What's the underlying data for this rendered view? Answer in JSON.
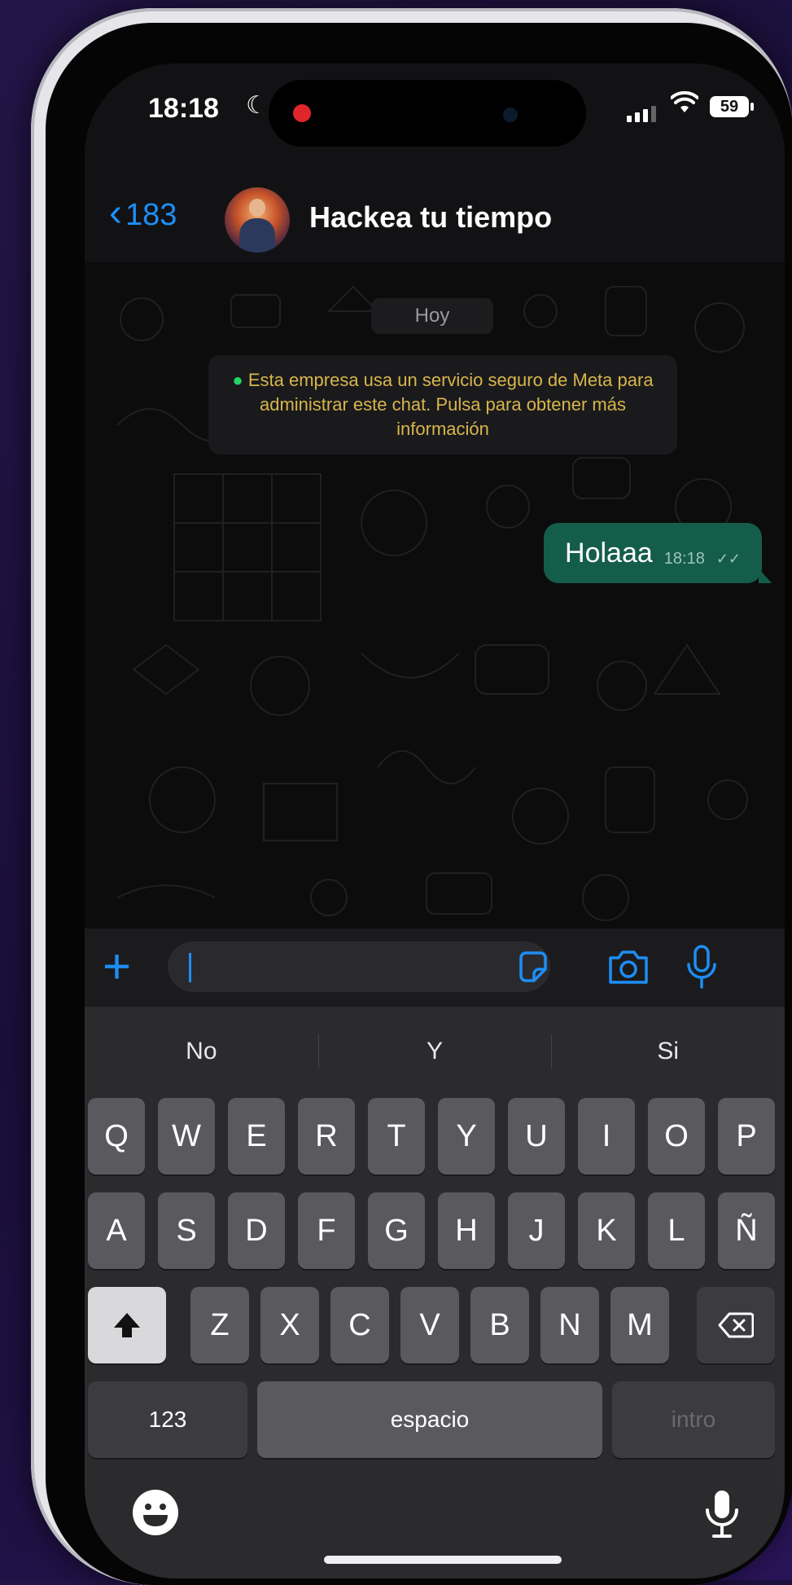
{
  "status_bar": {
    "time": "18:18",
    "battery": "59"
  },
  "header": {
    "back_count": "183",
    "title": "Hackea tu tiempo"
  },
  "chat": {
    "date_chip": "Hoy",
    "system_message": "Esta empresa usa un servicio seguro de Meta para administrar este chat. Pulsa para obtener más información",
    "messages": [
      {
        "text": "Holaaa",
        "time": "18:18",
        "status": "sent"
      }
    ]
  },
  "composer": {
    "input_value": "",
    "input_placeholder": ""
  },
  "keyboard": {
    "suggestions": [
      "No",
      "Y",
      "Si"
    ],
    "row1": [
      "Q",
      "W",
      "E",
      "R",
      "T",
      "Y",
      "U",
      "I",
      "O",
      "P"
    ],
    "row2": [
      "A",
      "S",
      "D",
      "F",
      "G",
      "H",
      "J",
      "K",
      "L",
      "Ñ"
    ],
    "row3": [
      "Z",
      "X",
      "C",
      "V",
      "B",
      "N",
      "M"
    ],
    "numbers_key": "123",
    "space_key": "espacio",
    "return_key": "intro"
  },
  "colors": {
    "accent": "#1d8ef5",
    "bubble_out": "#155d4b",
    "system_text": "#d8b64a"
  }
}
